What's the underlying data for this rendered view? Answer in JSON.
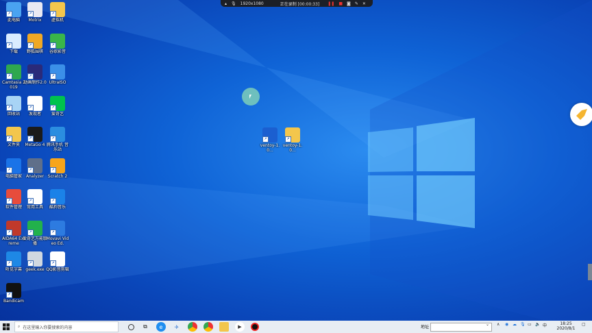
{
  "recorder": {
    "resolution": "1920x1080",
    "status": "正在录制 [00:00:33]"
  },
  "desktop_icons": [
    {
      "label": "此电脑",
      "icon": "computer-icon",
      "color": "#4aa3f0"
    },
    {
      "label": "Motrix",
      "icon": "motrix-icon",
      "color": "#e9e9f2"
    },
    {
      "label": "虚拟机",
      "icon": "folder-icon",
      "color": "#f3c64c"
    },
    {
      "label": "下载",
      "icon": "download-folder-icon",
      "color": "#d9ecff"
    },
    {
      "label": "野狐围棋",
      "icon": "go-game-icon",
      "color": "#f0a825"
    },
    {
      "label": "谷歌影音",
      "icon": "google-play-icon",
      "color": "#39b54a"
    },
    {
      "label": "Camtasia 2019",
      "icon": "camtasia-icon",
      "color": "#2fa84f"
    },
    {
      "label": "动画制作2.0",
      "icon": "animation-icon",
      "color": "#2a2a7a"
    },
    {
      "label": "UltraISO",
      "icon": "ultraiso-icon",
      "color": "#3b8fe8"
    },
    {
      "label": "回收站",
      "icon": "recycle-bin-icon",
      "color": "#a8d4f5"
    },
    {
      "label": "发现者",
      "icon": "panda-icon",
      "color": "#ffffff"
    },
    {
      "label": "爱奇艺",
      "icon": "iqiyi-icon",
      "color": "#00c34d"
    },
    {
      "label": "文件夹",
      "icon": "folder-icon",
      "color": "#f3c64c"
    },
    {
      "label": "MetaGo 4",
      "icon": "metago-icon",
      "color": "#1b1b1b"
    },
    {
      "label": "腾讯手机 音乐站",
      "icon": "cloud-icon",
      "color": "#2b8de0"
    },
    {
      "label": "电脑管家",
      "icon": "shield-icon",
      "color": "#1a73e8"
    },
    {
      "label": "Analyzer",
      "icon": "chart-icon",
      "color": "#5f6f8a"
    },
    {
      "label": "Scratch 2",
      "icon": "scratch-icon",
      "color": "#f7a51b"
    },
    {
      "label": "软件管理",
      "icon": "apps-icon",
      "color": "#e74c3c"
    },
    {
      "label": "常用工具",
      "icon": "document-icon",
      "color": "#ffffff"
    },
    {
      "label": "酷狗音乐",
      "icon": "kugou-icon",
      "color": "#1b82e8"
    },
    {
      "label": "AIDA64 Extreme",
      "icon": "aida64-icon",
      "color": "#c0392b"
    },
    {
      "label": "爱奇艺万能联播",
      "icon": "screen-cast-icon",
      "color": "#22b14c"
    },
    {
      "label": "Movavi Video Ed.",
      "icon": "movavi-icon",
      "color": "#2d7be0"
    },
    {
      "label": "听见字幕",
      "icon": "ear-icon",
      "color": "#1e88e5"
    },
    {
      "label": "geek.exe",
      "icon": "trash-can-icon",
      "color": "#d0d8e0"
    },
    {
      "label": "QQ影音剪辑",
      "icon": "document-icon",
      "color": "#ffffff"
    },
    {
      "label": "Bandicam",
      "icon": "record-icon",
      "color": "#111111"
    }
  ],
  "center_icons": [
    {
      "label": "ventoy-1.0...",
      "icon": "zip-icon",
      "color": "#1b5fd0"
    },
    {
      "label": "ventoy-1.0...",
      "icon": "folder-icon",
      "color": "#f3c64c"
    }
  ],
  "taskbar": {
    "search_placeholder": "在这里输入你要搜索的内容",
    "address_label": "地址",
    "ime_label": "中",
    "time": "18:25",
    "date": "2020/8/1"
  }
}
